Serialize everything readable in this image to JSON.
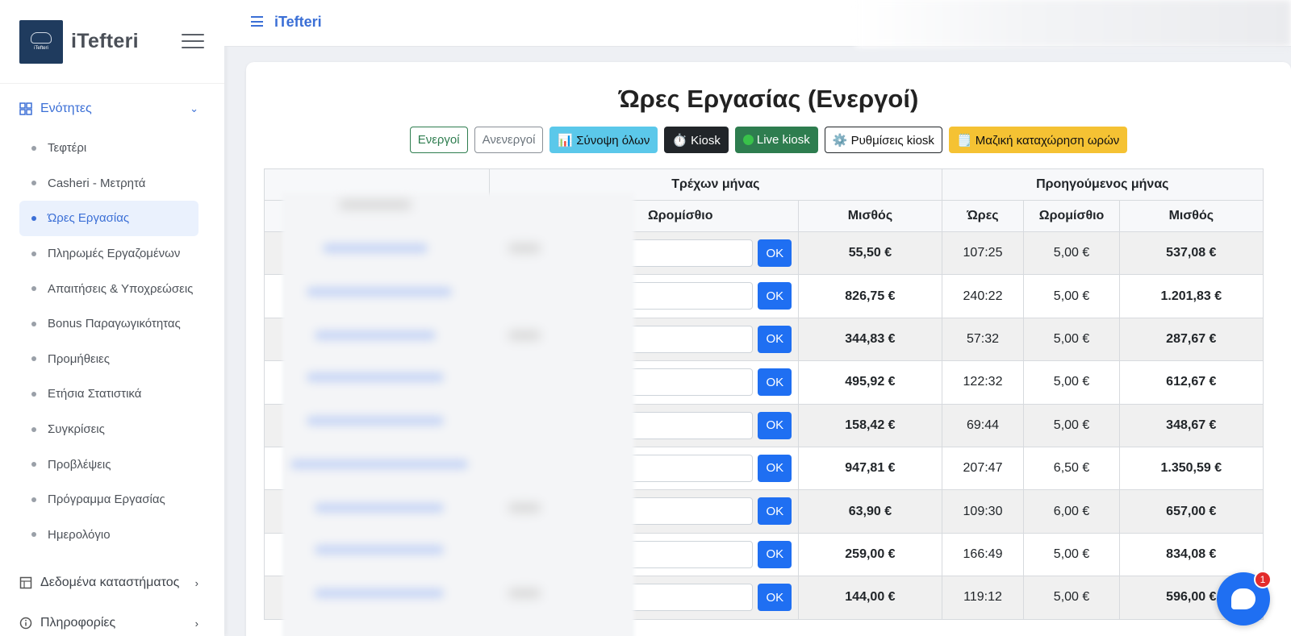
{
  "app": {
    "name": "iTefteri",
    "logo_text": "iTefteri"
  },
  "sidebar": {
    "sections_label": "Ενότητες",
    "items": [
      {
        "label": "Τεφτέρι",
        "active": false
      },
      {
        "label": "Casheri - Μετρητά",
        "active": false
      },
      {
        "label": "Ώρες Εργασίας",
        "active": true
      },
      {
        "label": "Πληρωμές Εργαζομένων",
        "active": false
      },
      {
        "label": "Απαιτήσεις & Υποχρεώσεις",
        "active": false
      },
      {
        "label": "Bonus Παραγωγικότητας",
        "active": false
      },
      {
        "label": "Προμήθειες",
        "active": false
      },
      {
        "label": "Ετήσια Στατιστικά",
        "active": false
      },
      {
        "label": "Συγκρίσεις",
        "active": false
      },
      {
        "label": "Προβλέψεις",
        "active": false
      },
      {
        "label": "Πρόγραμμα Εργασίας",
        "active": false
      },
      {
        "label": "Ημερολόγιο",
        "active": false
      }
    ],
    "store_data_label": "Δεδομένα καταστήματος",
    "info_label": "Πληροφορίες"
  },
  "topbar": {
    "title": "iTefteri"
  },
  "page": {
    "title": "Ώρες Εργασίας (Ενεργοί)",
    "buttons": {
      "active": "Ενεργοί",
      "inactive": "Ανενεργοί",
      "summary": "📊 Σύνοψη όλων",
      "kiosk": "⏱️ Kiosk",
      "live_kiosk": "Live kiosk",
      "kiosk_settings": "⚙️ Ρυθμίσεις kiosk",
      "mass_entry": "🗒️ Μαζική καταχώρηση ωρών"
    }
  },
  "table": {
    "group_current": "Τρέχων μήνας",
    "group_previous": "Προηγούμενος μήνας",
    "headers": {
      "cur_rate": "Ωρομίσθιο",
      "cur_salary": "Μισθός",
      "prev_hours": "Ώρες",
      "prev_rate": "Ωρομίσθιο",
      "prev_salary": "Μισθός"
    },
    "ok_label": "OK",
    "rows": [
      {
        "cur_salary": "55,50 €",
        "prev_hours": "107:25",
        "prev_rate": "5,00 €",
        "prev_salary": "537,08 €"
      },
      {
        "cur_salary": "826,75 €",
        "prev_hours": "240:22",
        "prev_rate": "5,00 €",
        "prev_salary": "1.201,83 €"
      },
      {
        "cur_salary": "344,83 €",
        "prev_hours": "57:32",
        "prev_rate": "5,00 €",
        "prev_salary": "287,67 €"
      },
      {
        "cur_salary": "495,92 €",
        "prev_hours": "122:32",
        "prev_rate": "5,00 €",
        "prev_salary": "612,67 €"
      },
      {
        "cur_salary": "158,42 €",
        "prev_hours": "69:44",
        "prev_rate": "5,00 €",
        "prev_salary": "348,67 €"
      },
      {
        "cur_salary": "947,81 €",
        "prev_hours": "207:47",
        "prev_rate": "6,50 €",
        "prev_salary": "1.350,59 €"
      },
      {
        "cur_salary": "63,90 €",
        "prev_hours": "109:30",
        "prev_rate": "6,00 €",
        "prev_salary": "657,00 €"
      },
      {
        "cur_salary": "259,00 €",
        "prev_hours": "166:49",
        "prev_rate": "5,00 €",
        "prev_salary": "834,08 €"
      },
      {
        "cur_salary": "144,00 €",
        "prev_hours": "119:12",
        "prev_rate": "5,00 €",
        "prev_salary": "596,00 €"
      }
    ]
  },
  "chat": {
    "badge": "1"
  }
}
